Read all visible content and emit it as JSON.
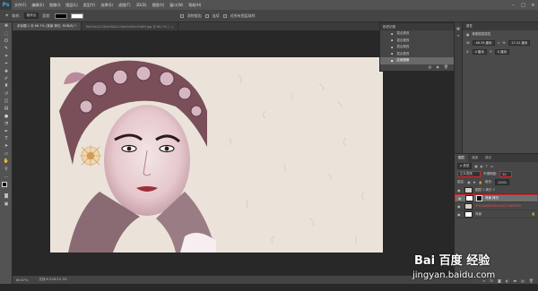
{
  "app": {
    "logo": "Ps"
  },
  "menubar": {
    "items": [
      "文件(F)",
      "编辑(E)",
      "图像(I)",
      "图层(L)",
      "类型(Y)",
      "选择(S)",
      "滤镜(T)",
      "3D(D)",
      "视图(V)",
      "窗口(W)",
      "帮助(H)"
    ]
  },
  "options": {
    "sample_label": "取样:",
    "sample_value": "取样点",
    "tolerance_label": "容差:",
    "antialias": "消除锯齿",
    "contiguous": "连续",
    "all_layers": "对所有图层取样"
  },
  "tabs": [
    "未标题-1 @ 66.7% (背景 拷贝, RGB/8) *",
    "9fe02a1f12b0e9d41240b4d3d1d7a8ff.jpg @ 66.7% (...)"
  ],
  "history": {
    "title": "历史记录",
    "items": [
      "混合更改",
      "混合更改",
      "混合更改",
      "混合更改",
      "混合更改",
      "混合更改",
      "混合更改"
    ],
    "selected": "应用图像"
  },
  "properties": {
    "title": "属性",
    "subtitle": "像素图层属性",
    "w_label": "W:",
    "w_value": "48.76 厘米",
    "h_label": "H:",
    "h_value": "27.22 厘米",
    "x_label": "X:",
    "x_value": "0 厘米",
    "y_label": "Y:",
    "y_value": "0 厘米"
  },
  "layers_panel": {
    "tabs": [
      "图层",
      "通道",
      "路径"
    ],
    "kind_label": "p 类型",
    "blend_mode": "正片叠底",
    "opacity_label": "不透明度:",
    "opacity_value": "50",
    "lock_label": "锁定:",
    "fill_label": "填充:",
    "fill_value": "100%",
    "layers": [
      {
        "name": "图层 1 拷贝 2",
        "selected": false
      },
      {
        "name": "背景 拷贝",
        "selected": true
      },
      {
        "name": "9f1c0e080162d1b274894f59",
        "selected": false
      },
      {
        "name": "背景",
        "selected": false
      }
    ]
  },
  "status": {
    "zoom": "66.67%",
    "doc": "文档:6.51M/10.7M"
  },
  "watermark": {
    "brand": "Bai 百度 经验",
    "url": "jingyan.baidu.com"
  }
}
